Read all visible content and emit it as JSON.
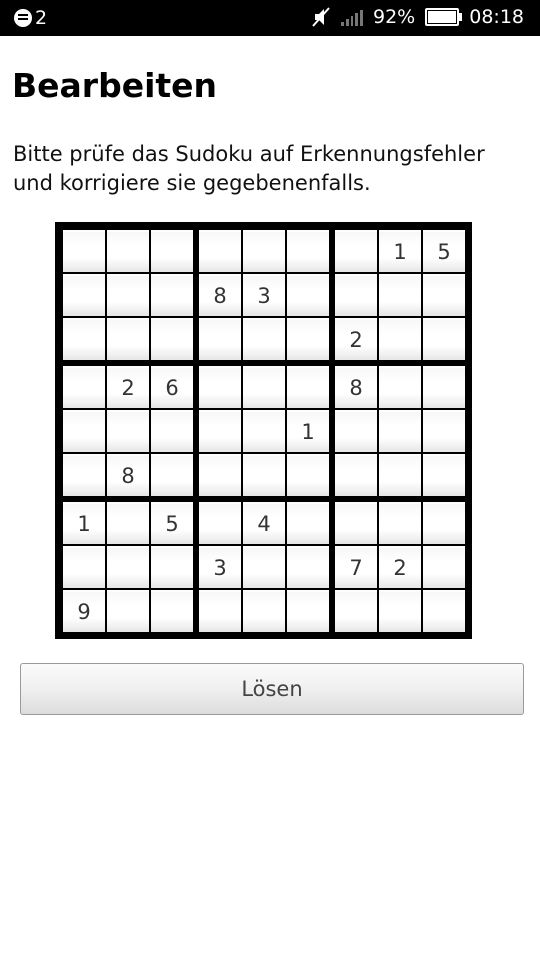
{
  "status_bar": {
    "notification_count": "2",
    "battery": "92%",
    "time": "08:18",
    "battery_level": 0.92,
    "icons": [
      "notification-icon",
      "mute-icon",
      "signal-icon",
      "battery-icon"
    ]
  },
  "page": {
    "title": "Bearbeiten",
    "instructions": "Bitte prüfe das Sudoku auf Erkennungsfehler und korrigiere sie gegebenenfalls."
  },
  "sudoku": {
    "grid": [
      [
        "",
        "",
        "",
        "",
        "",
        "",
        "",
        "1",
        "5"
      ],
      [
        "",
        "",
        "",
        "8",
        "3",
        "",
        "",
        "",
        ""
      ],
      [
        "",
        "",
        "",
        "",
        "",
        "",
        "2",
        "",
        ""
      ],
      [
        "",
        "2",
        "6",
        "",
        "",
        "",
        "8",
        "",
        ""
      ],
      [
        "",
        "",
        "",
        "",
        "",
        "1",
        "",
        "",
        ""
      ],
      [
        "",
        "8",
        "",
        "",
        "",
        "",
        "",
        "",
        ""
      ],
      [
        "1",
        "",
        "5",
        "",
        "4",
        "",
        "",
        "",
        ""
      ],
      [
        "",
        "",
        "",
        "3",
        "",
        "",
        "7",
        "2",
        ""
      ],
      [
        "9",
        "",
        "",
        "",
        "",
        "",
        "",
        "",
        ""
      ]
    ]
  },
  "actions": {
    "solve_label": "Lösen"
  },
  "colors": {
    "status_bar_bg": "#000000",
    "board_border": "#000000",
    "background": "#ffffff"
  }
}
